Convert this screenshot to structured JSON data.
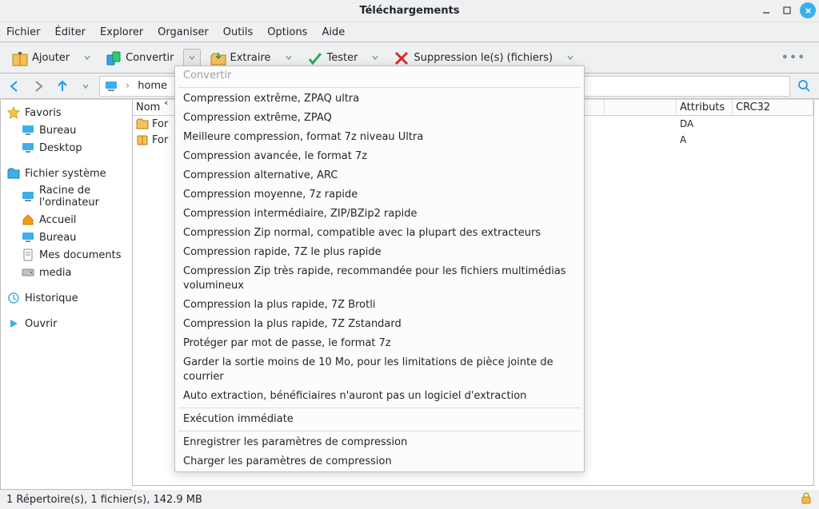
{
  "window": {
    "title": "Téléchargements"
  },
  "menu": {
    "file": "Fichier",
    "edit": "Éditer",
    "explore": "Explorer",
    "organize": "Organiser",
    "tools": "Outils",
    "options": "Options",
    "help": "Aide"
  },
  "toolbar": {
    "add": "Ajouter",
    "convert": "Convertir",
    "extract": "Extraire",
    "test": "Tester",
    "delete": "Suppression le(s) (fichiers)"
  },
  "breadcrumb": {
    "root": "home"
  },
  "sidebar": {
    "favorites": {
      "title": "Favoris",
      "bureau": "Bureau",
      "desktop": "Desktop"
    },
    "fs": {
      "title": "Fichier système",
      "root": "Racine de l'ordinateur",
      "home": "Accueil",
      "desktop": "Bureau",
      "docs": "Mes documents",
      "media": "media"
    },
    "history": "Historique",
    "open": "Ouvrir"
  },
  "columns": {
    "name": "Nom ˂",
    "date": "",
    "size": "",
    "attrs": "Attributs",
    "crc": "CRC32"
  },
  "rows": [
    {
      "name": "For",
      "attrs": "DA"
    },
    {
      "name": "For",
      "attrs": "A"
    }
  ],
  "menu_items": [
    {
      "label": "Convertir",
      "disabled": true
    },
    {
      "sep": true
    },
    {
      "label": "Compression extrême, ZPAQ ultra"
    },
    {
      "label": "Compression extrême, ZPAQ"
    },
    {
      "label": "Meilleure compression, format 7z niveau Ultra"
    },
    {
      "label": "Compression avancée, le format 7z"
    },
    {
      "label": "Compression alternative, ARC"
    },
    {
      "label": "Compression moyenne, 7z rapide"
    },
    {
      "label": "Compression intermédiaire, ZIP/BZip2 rapide"
    },
    {
      "label": "Compression Zip normal, compatible avec la plupart des extracteurs"
    },
    {
      "label": "Compression rapide, 7Z le plus rapide"
    },
    {
      "label": "Compression Zip très rapide, recommandée pour les fichiers multimédias volumineux"
    },
    {
      "label": "Compression la plus rapide, 7Z Brotli"
    },
    {
      "label": "Compression la plus rapide, 7Z Zstandard"
    },
    {
      "label": "Protéger par mot de passe, le format 7z"
    },
    {
      "label": "Garder la sortie moins de 10 Mo, pour les limitations de pièce jointe de courrier"
    },
    {
      "label": "Auto extraction, bénéficiaires n'auront pas un logiciel d'extraction"
    },
    {
      "sep": true
    },
    {
      "label": "Exécution immédiate"
    },
    {
      "sep": true
    },
    {
      "label": "Enregistrer les paramètres de compression"
    },
    {
      "label": "Charger les paramètres de compression"
    }
  ],
  "status": {
    "text": "1 Répertoire(s), 1 fichier(s), 142.9 MB"
  }
}
